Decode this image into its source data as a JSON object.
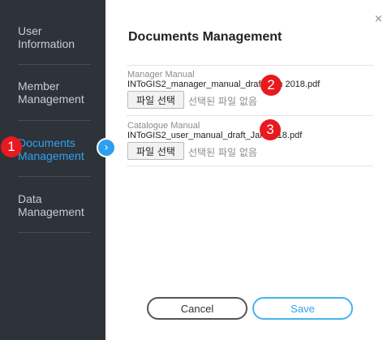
{
  "sidebar": {
    "items": [
      {
        "line1": "User",
        "line2": "Information"
      },
      {
        "line1": "Member",
        "line2": "Management"
      },
      {
        "line1": "Documents",
        "line2": "Management"
      },
      {
        "line1": "Data",
        "line2": "Management"
      }
    ],
    "active_marker_icon": "chevron-right-icon",
    "accent_color": "#2fa3ef",
    "background_color": "#2e3239"
  },
  "dialog": {
    "close_icon": "×",
    "title": "Documents Management",
    "fields": [
      {
        "label": "Manager Manual",
        "current_file": "INToGIS2_manager_manual_draft_Jan 2018.pdf",
        "choose_button": "파일 선택",
        "no_file_text": "선택된 파일 없음"
      },
      {
        "label": "Catalogue Manual",
        "current_file": "INToGIS2_user_manual_draft_Jan 2018.pdf",
        "choose_button": "파일 선택",
        "no_file_text": "선택된 파일 없음"
      }
    ],
    "cancel_label": "Cancel",
    "save_label": "Save"
  },
  "annotations": [
    "1",
    "2",
    "3"
  ],
  "annotation_color": "#e8191f"
}
